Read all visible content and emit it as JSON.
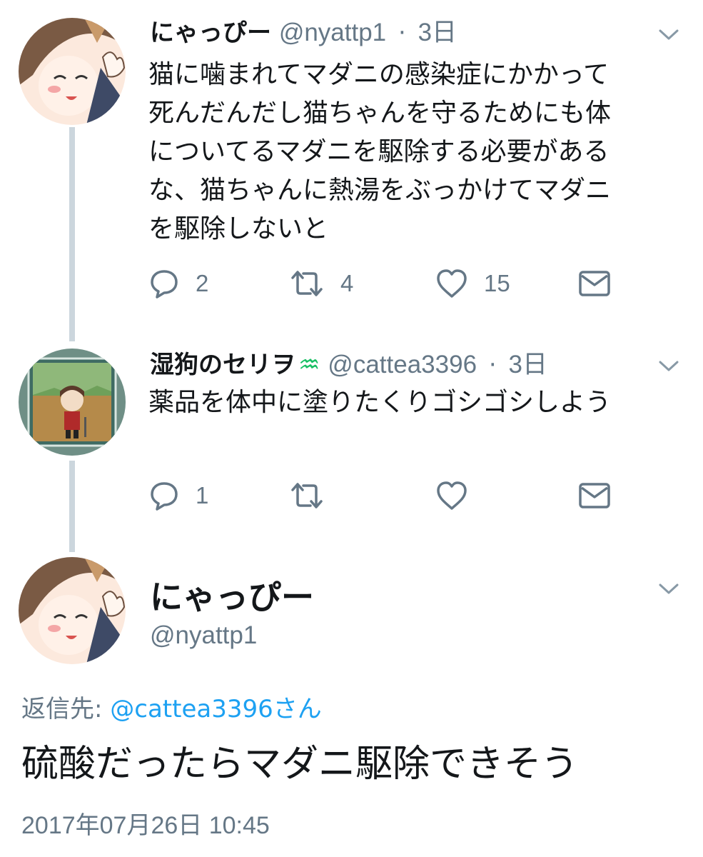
{
  "tweets": [
    {
      "name": "にゃっぴー",
      "handle": "@nyattp1",
      "separator": "·",
      "time": "3日",
      "text_lines": [
        "猫に噛まれてマダニの感染症にかかって",
        "死んだんだし猫ちゃんを守るためにも体",
        "についてるマダニを駆除する必要がある",
        "な、猫ちゃんに熱湯をぶっかけてマダニ",
        "を駆除しないと"
      ],
      "replies": "2",
      "retweets": "4",
      "likes": "15"
    },
    {
      "name": "湿狗のセリヲ",
      "name_emoji": "♒",
      "handle": "@cattea3396",
      "separator": "·",
      "time": "3日",
      "text_lines": [
        "薬品を体中に塗りたくりゴシゴシしよう"
      ],
      "replies": "1",
      "retweets": "",
      "likes": ""
    }
  ],
  "main_tweet": {
    "name": "にゃっぴー",
    "handle": "@nyattp1",
    "reply_prefix": "返信先: ",
    "reply_mention": "@cattea3396さん",
    "text": "硫酸だったらマダニ駆除できそう",
    "timestamp": "2017年07月26日 10:45"
  },
  "icons": {
    "reply": "reply-bubble-icon",
    "retweet": "retweet-arrows-icon",
    "like": "heart-icon",
    "dm": "envelope-icon",
    "menu": "chevron-down-icon"
  },
  "colors": {
    "text": "#14171a",
    "secondary": "#657786",
    "link": "#1da1f2",
    "thread": "#ccd6dd",
    "emoji_green": "#17bf63"
  }
}
